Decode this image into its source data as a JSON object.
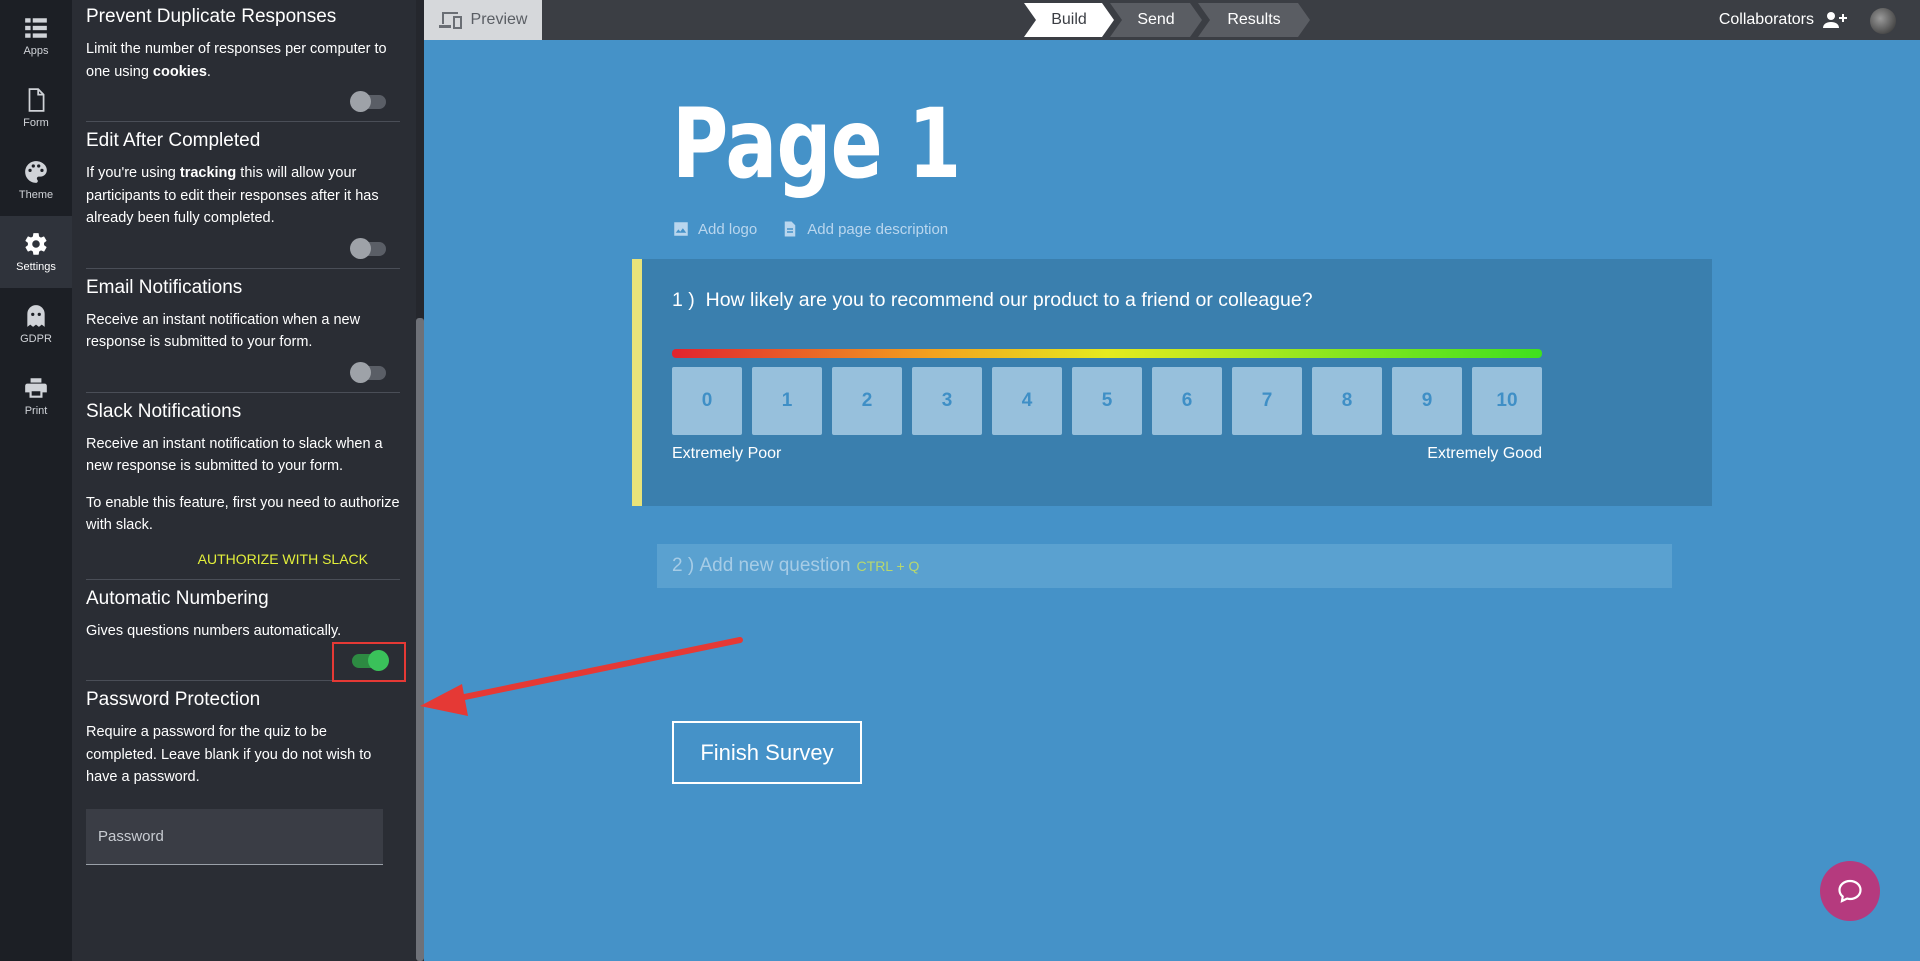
{
  "rail": [
    {
      "label": "Apps",
      "icon": "apps-icon"
    },
    {
      "label": "Form",
      "icon": "form-icon"
    },
    {
      "label": "Theme",
      "icon": "palette-icon"
    },
    {
      "label": "Settings",
      "icon": "gear-icon"
    },
    {
      "label": "GDPR",
      "icon": "ghost-icon"
    },
    {
      "label": "Print",
      "icon": "printer-icon"
    }
  ],
  "settings": {
    "prevent_duplicates": {
      "title": "Prevent Duplicate Responses",
      "desc_pre": "Limit the number of responses per computer to one using ",
      "desc_bold": "cookies",
      "desc_post": ".",
      "enabled": false
    },
    "edit_after": {
      "title": "Edit After Completed",
      "desc_pre": "If you're using ",
      "desc_bold": "tracking",
      "desc_post": " this will allow your participants to edit their responses after it has already been fully completed.",
      "enabled": false
    },
    "email": {
      "title": "Email Notifications",
      "desc": "Receive an instant notification when a new response is submitted to your form.",
      "enabled": false
    },
    "slack": {
      "title": "Slack Notifications",
      "desc": "Receive an instant notification to slack when a new response is submitted to your form.",
      "desc2": "To enable this feature, first you need to authorize with slack.",
      "action": "AUTHORIZE WITH SLACK"
    },
    "numbering": {
      "title": "Automatic Numbering",
      "desc": "Gives questions numbers automatically.",
      "enabled": true
    },
    "password": {
      "title": "Password Protection",
      "desc": "Require a password for the quiz to be completed. Leave blank if you do not wish to have a password.",
      "placeholder": "Password"
    }
  },
  "topbar": {
    "preview": "Preview",
    "steps": [
      "Build",
      "Send",
      "Results"
    ],
    "collaborators": "Collaborators"
  },
  "page": {
    "title": "Page 1",
    "add_logo": "Add logo",
    "add_description": "Add page description"
  },
  "question": {
    "number": "1 )",
    "text": "How likely are you to recommend our product to a friend or colleague?",
    "scale": [
      "0",
      "1",
      "2",
      "3",
      "4",
      "5",
      "6",
      "7",
      "8",
      "9",
      "10"
    ],
    "low_label": "Extremely Poor",
    "high_label": "Extremely Good"
  },
  "new_question": {
    "number": "2 )",
    "text": "Add new question",
    "shortcut": "CTRL + Q"
  },
  "finish": "Finish Survey",
  "colors": {
    "accent": "#4592c8",
    "toggle_on": "#3ac15a",
    "highlight": "#e53935",
    "slack": "#e3ef3a",
    "chat": "#b53a7e"
  }
}
